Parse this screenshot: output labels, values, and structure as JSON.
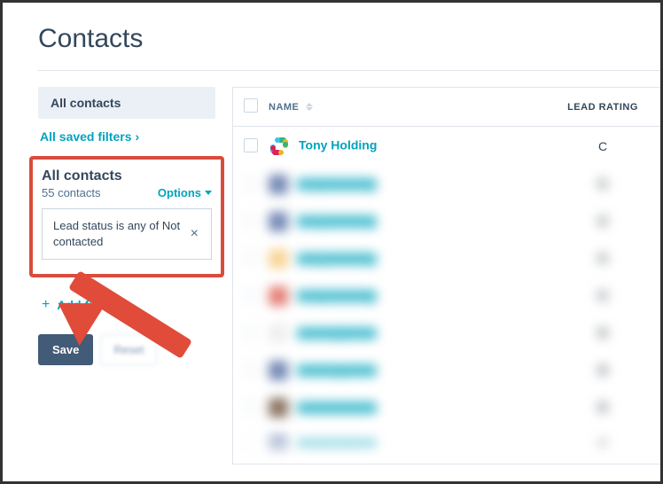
{
  "page": {
    "title": "Contacts"
  },
  "sidebar": {
    "active_view": "All contacts",
    "saved_filters_label": "All saved filters",
    "filter_group": {
      "title": "All contacts",
      "count": "55 contacts",
      "options_label": "Options",
      "chip_text": "Lead status is any of Not contacted"
    },
    "add_filter_label": "Add filter",
    "save_label": "Save",
    "reset_label": "Reset"
  },
  "table": {
    "columns": {
      "name": "NAME",
      "lead_rating": "LEAD RATING"
    },
    "rows": [
      {
        "name": "Tony Holding",
        "rating": "C",
        "avatar_color": "slack",
        "blurred": false
      },
      {
        "name": "Tony Holding",
        "rating": "C",
        "avatar_color": "#3b5998",
        "blurred": true
      },
      {
        "name": "Tony Holding",
        "rating": "C",
        "avatar_color": "#3b5998",
        "blurred": true
      },
      {
        "name": "Tony Holding",
        "rating": "C",
        "avatar_color": "#f5c26b",
        "blurred": true
      },
      {
        "name": "Tony Holding",
        "rating": "C",
        "avatar_color": "#d94c3d",
        "blurred": true
      },
      {
        "name": "Tom Ingram",
        "rating": "B",
        "avatar_color": "#e8e8e8",
        "blurred": true
      },
      {
        "name": "Tom Ingram",
        "rating": "B",
        "avatar_color": "#3b5998",
        "blurred": true
      },
      {
        "name": "Tom Helm",
        "rating": "B",
        "avatar_color": "#5a3a22",
        "blurred": true
      },
      {
        "name": "Tom Helm",
        "rating": "B",
        "avatar_color": "#3b5998",
        "blurred": true
      }
    ]
  },
  "annotation": {
    "highlight": "filter-group",
    "arrow_target": "add-filter"
  }
}
